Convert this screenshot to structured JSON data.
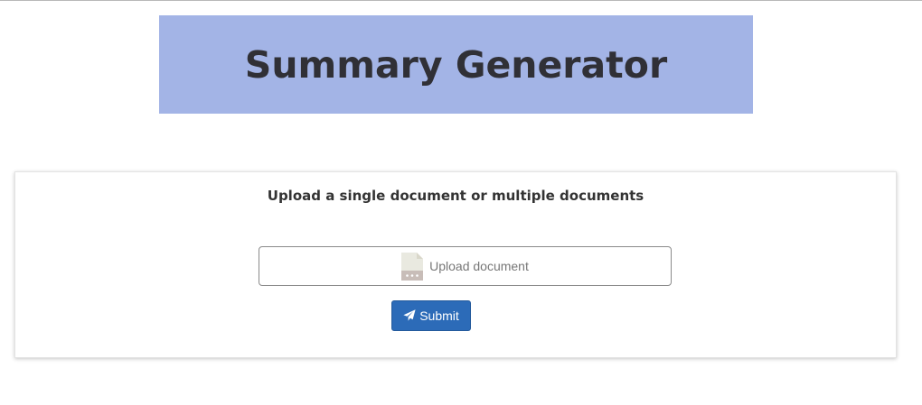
{
  "header": {
    "title": "Summary Generator",
    "background_color": "#a3b4e6"
  },
  "upload_card": {
    "heading": "Upload a single document or multiple documents",
    "file_input": {
      "label": "Upload document",
      "icon": "document-file-icon"
    },
    "submit_button": {
      "label": "Submit",
      "icon": "paper-plane-icon",
      "color": "#2c6bb8"
    }
  }
}
